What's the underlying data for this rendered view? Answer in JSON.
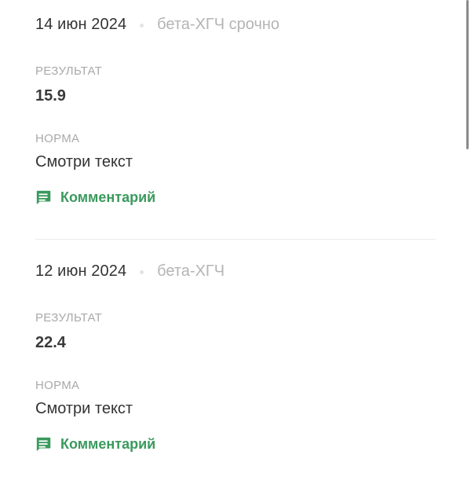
{
  "entries": [
    {
      "date": "14 июн 2024",
      "test_name": "бета-ХГЧ срочно",
      "result_label": "РЕЗУЛЬТАТ",
      "result_value": "15.9",
      "norm_label": "НОРМА",
      "norm_value": "Смотри текст",
      "comment_label": "Комментарий"
    },
    {
      "date": "12 июн 2024",
      "test_name": "бета-ХГЧ",
      "result_label": "РЕЗУЛЬТАТ",
      "result_value": "22.4",
      "norm_label": "НОРМА",
      "norm_value": "Смотри текст",
      "comment_label": "Комментарий"
    }
  ],
  "icons": {
    "comment": "comment-icon"
  },
  "colors": {
    "accent": "#3a9a5d",
    "muted": "#a9a9a9"
  }
}
